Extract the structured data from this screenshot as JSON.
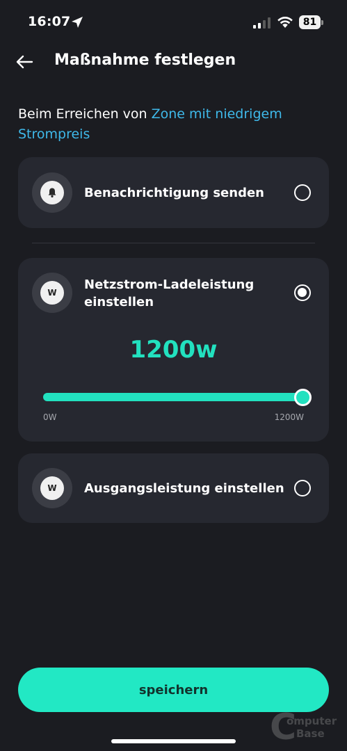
{
  "status_bar": {
    "time": "16:07",
    "battery": "81"
  },
  "header": {
    "title": "Maßnahme festlegen"
  },
  "trigger": {
    "prefix": "Beim Erreichen von ",
    "zone": "Zone mit niedrigem Strompreis"
  },
  "options": [
    {
      "label": "Benachrichtigung senden",
      "icon": "bell-icon",
      "selected": false
    },
    {
      "label": "Netzstrom-Ladeleistung einstellen",
      "icon": "watt-icon",
      "icon_text": "W",
      "selected": true,
      "value_display": "1200w",
      "value": 1200,
      "min_label": "0W",
      "max_label": "1200W"
    },
    {
      "label": "Ausgangsleistung einstellen",
      "icon": "watt-icon",
      "icon_text": "W",
      "selected": false
    }
  ],
  "footer": {
    "save_label": "speichern"
  },
  "watermark": {
    "line1": "omputer",
    "line2": "Base"
  },
  "colors": {
    "background": "#1b1c21",
    "card": "#262830",
    "accent": "#22e1bf",
    "link": "#3fb9ea"
  }
}
